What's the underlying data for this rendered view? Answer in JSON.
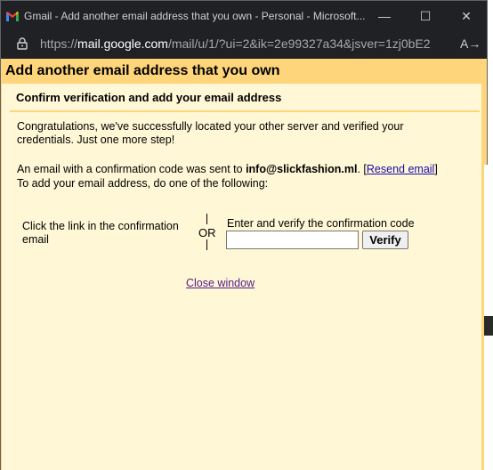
{
  "window": {
    "title": "Gmail - Add another email address that you own - Personal - Microsoft...",
    "controls": {
      "minimize": "—",
      "maximize": "☐",
      "close": "✕"
    },
    "icon": "gmail-icon"
  },
  "address_bar": {
    "prefix": "https://",
    "host": "mail.google.com",
    "path": "/mail/u/1/?ui=2&ik=2e99327a34&jsver=1zj0bE2...",
    "reader_icon": "A→",
    "lock_icon": "lock-icon"
  },
  "dialog": {
    "heading": "Add another email address that you own",
    "subheading": "Confirm verification and add your email address",
    "congrats": "Congratulations, we've successfully located your other server and verified your credentials. Just one more step!",
    "sent_prefix": "An email with a confirmation code was sent to ",
    "email": "info@slickfashion.ml",
    "sent_suffix": ". [",
    "resend_label": "Resend email",
    "resend_close": "]",
    "instructions": "To add your email address, do one of the following:",
    "option_link": "Click the link in the confirmation email",
    "or_label": "OR",
    "option_code_label": "Enter and verify the confirmation code",
    "code_input_value": "",
    "code_input_placeholder": "",
    "verify_label": "Verify",
    "close_label": "Close window"
  },
  "colors": {
    "dialog_bg": "#fff7d5",
    "header_bar": "#ffd57b",
    "link": "#1a0dab",
    "visited_link": "#551a8b"
  }
}
